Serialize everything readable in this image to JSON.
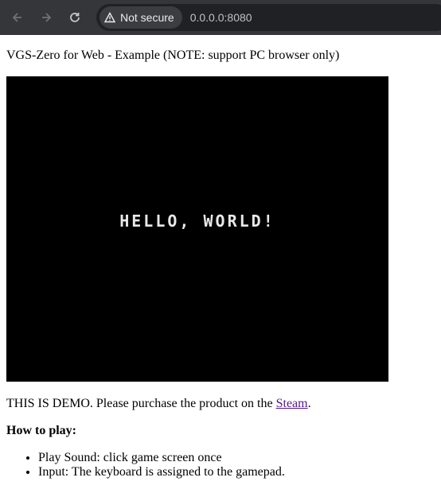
{
  "browser": {
    "security_label": "Not secure",
    "url": "0.0.0.0:8080"
  },
  "page": {
    "heading": "VGS-Zero for Web - Example (NOTE: support PC browser only)",
    "game_screen_text": "HELLO, WORLD!",
    "demo_text_before": "THIS IS DEMO. Please purchase the product on the ",
    "demo_link": "Steam",
    "demo_text_after": ".",
    "howto_title": "How to play:",
    "instructions": [
      "Play Sound: click game screen once",
      "Input: The keyboard is assigned to the gamepad."
    ]
  },
  "colors": {
    "toolbar": "#35363a",
    "omnibox": "#202124",
    "canvas": "#000000",
    "link_visited": "#551a8b"
  }
}
